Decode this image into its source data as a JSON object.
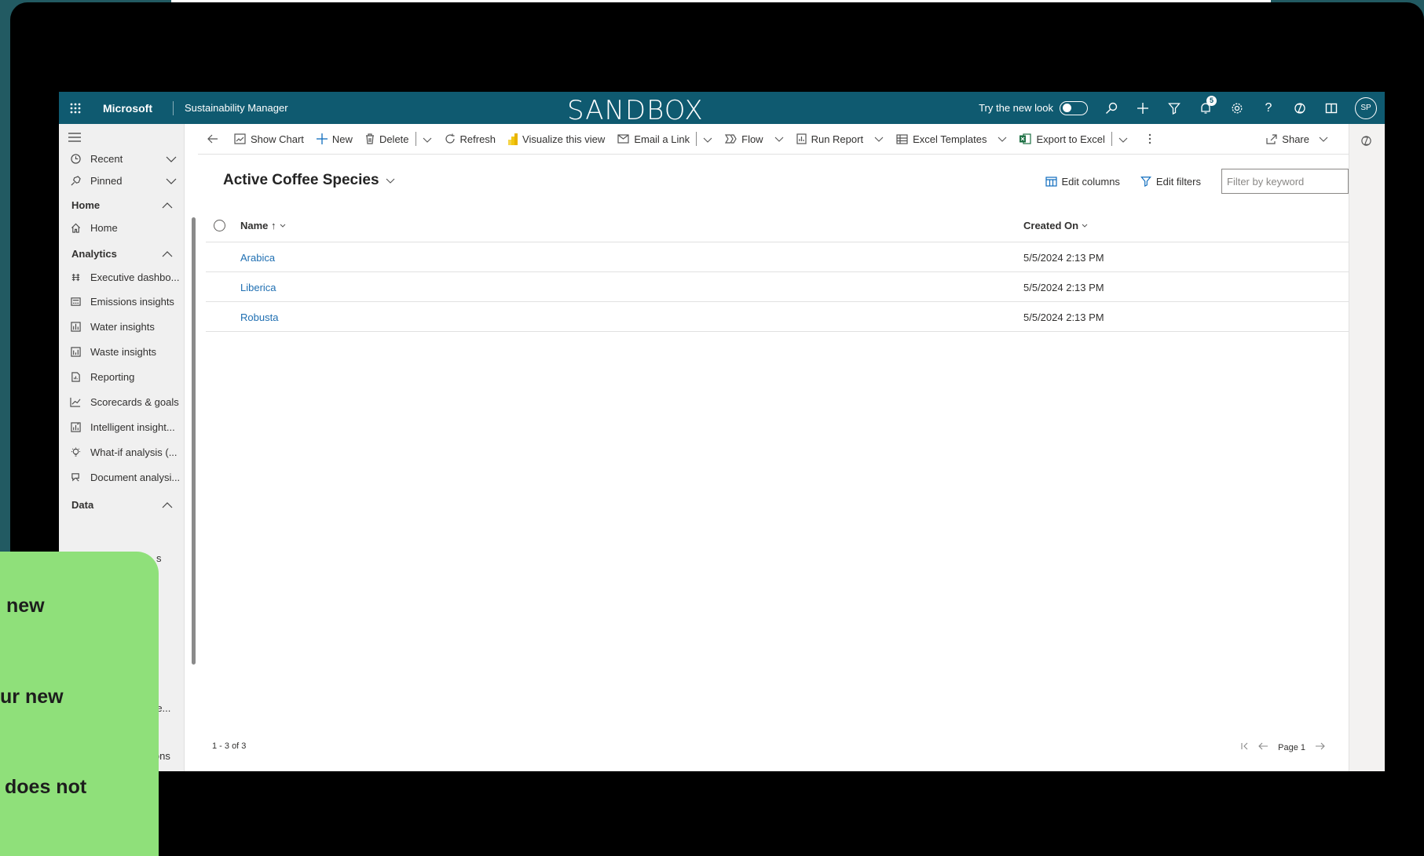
{
  "topbar": {
    "brand": "Microsoft",
    "app_name": "Sustainability Manager",
    "environment": "SANDBOX",
    "try_new_look": "Try the new look",
    "notification_count": "5",
    "avatar_initials": "SP",
    "color": "#0f5a70"
  },
  "sidebar": {
    "recent": "Recent",
    "pinned": "Pinned",
    "groups": {
      "home": "Home",
      "analytics": "Analytics",
      "data": "Data"
    },
    "home_items": [
      {
        "label": "Home",
        "icon": "home-icon"
      }
    ],
    "analytics_items": [
      {
        "label": "Executive dashbo...",
        "icon": "dashboard-icon"
      },
      {
        "label": "Emissions insights",
        "icon": "insights-icon"
      },
      {
        "label": "Water insights",
        "icon": "bar-chart-icon"
      },
      {
        "label": "Waste insights",
        "icon": "bar-chart-icon"
      },
      {
        "label": "Reporting",
        "icon": "report-icon"
      },
      {
        "label": "Scorecards & goals",
        "icon": "line-chart-icon"
      },
      {
        "label": "Intelligent insight...",
        "icon": "intelligent-icon"
      },
      {
        "label": "What-if analysis (...",
        "icon": "lightbulb-icon"
      },
      {
        "label": "Document analysi...",
        "icon": "document-icon"
      }
    ],
    "partial_labels": [
      "s",
      "re...",
      "ions"
    ]
  },
  "commands": {
    "show_chart": "Show Chart",
    "new": "New",
    "delete": "Delete",
    "refresh": "Refresh",
    "visualize": "Visualize this view",
    "email_link": "Email a Link",
    "flow": "Flow",
    "run_report": "Run Report",
    "excel_templates": "Excel Templates",
    "export_excel": "Export to Excel",
    "share": "Share"
  },
  "view": {
    "title": "Active Coffee Species",
    "edit_columns": "Edit columns",
    "edit_filters": "Edit filters",
    "filter_placeholder": "Filter by keyword",
    "columns": {
      "name": "Name ↑",
      "created_on": "Created On"
    },
    "rows": [
      {
        "name": "Arabica",
        "created_on": "5/5/2024 2:13 PM"
      },
      {
        "name": "Liberica",
        "created_on": "5/5/2024 2:13 PM"
      },
      {
        "name": "Robusta",
        "created_on": "5/5/2024 2:13 PM"
      }
    ],
    "record_count": "1 - 3 of 3",
    "page": "Page 1"
  },
  "overlay": {
    "lines": [
      "new",
      "ur new",
      "does not"
    ],
    "color": "#8fe07a"
  }
}
